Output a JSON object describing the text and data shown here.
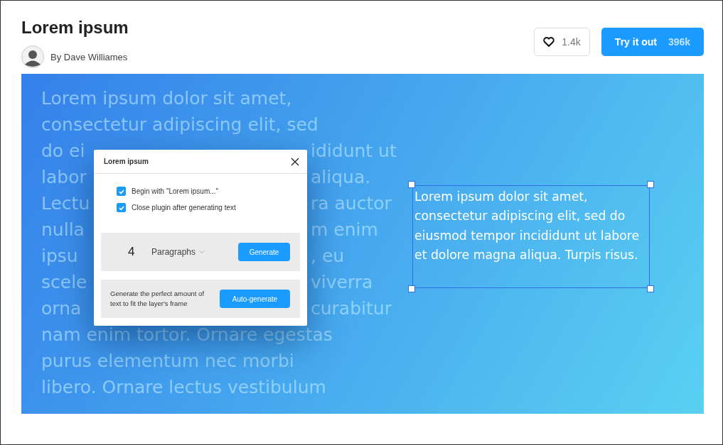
{
  "header": {
    "title": "Lorem ipsum",
    "author": "By Dave Williames",
    "like_count": "1.4k",
    "try_button": {
      "label": "Try it out",
      "count": "396k"
    }
  },
  "preview": {
    "background_lines": [
      {
        "left": "Lorem ipsum dolor sit amet,"
      },
      {
        "left": "consectetur adipiscing elit, sed"
      },
      {
        "left": "do ei",
        "right": "ididunt ut"
      },
      {
        "left": "labor",
        "right": "aliqua."
      },
      {
        "left": "Lectu",
        "right": "ra auctor"
      },
      {
        "left": "nulla",
        "right": "m enim"
      },
      {
        "left": "ipsu",
        "right": ", eu"
      },
      {
        "left": "scele",
        "right": "viverra"
      },
      {
        "left": "orna",
        "right": "curabitur"
      },
      {
        "left": "nam enim tortor. Ornare egestas"
      },
      {
        "left": "purus elementum nec morbi"
      },
      {
        "left": "libero. Ornare lectus vestibulum"
      }
    ],
    "dialog": {
      "title": "Lorem ipsum",
      "options": [
        {
          "label": "Begin with \"Lorem ipsum...\"",
          "checked": true
        },
        {
          "label": "Close plugin after generating text",
          "checked": true
        }
      ],
      "count": "4",
      "unit": "Paragraphs",
      "generate_button": "Generate",
      "auto_text": "Generate the perfect amount of text to fit the layer's frame",
      "auto_button": "Auto-generate"
    },
    "selected_text": "Lorem ipsum dolor sit amet, consectetur adipiscing elit, sed do eiusmod tempor incididunt ut labore et dolore magna aliqua. Turpis risus."
  }
}
